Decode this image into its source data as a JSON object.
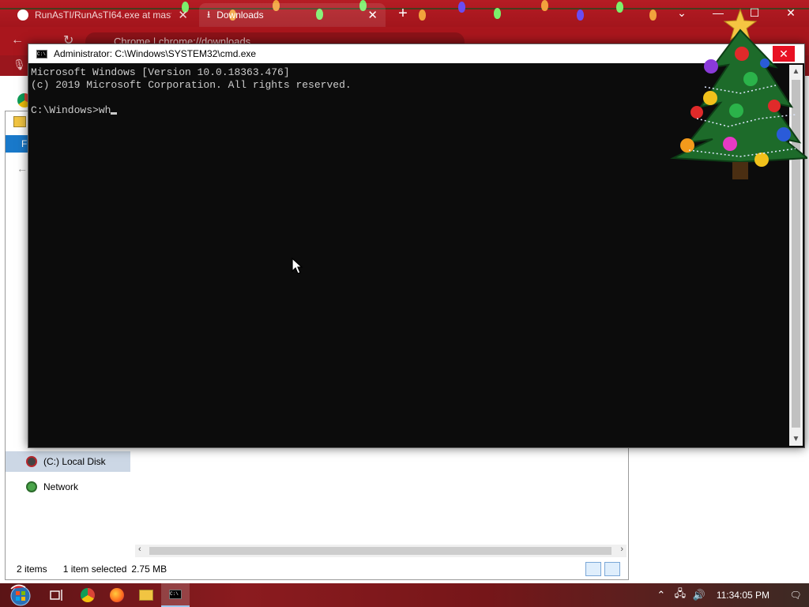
{
  "chrome": {
    "tabs": [
      {
        "label": "RunAsTI/RunAsTI64.exe at mast",
        "active": false
      },
      {
        "label": "Downloads",
        "active": true
      }
    ],
    "new_tab": "+",
    "address": "Chrome  |  chrome://downloads",
    "window_controls": {
      "minimize": "—",
      "maximize": "☐",
      "close": "✕"
    }
  },
  "explorer": {
    "ribbon_tab": "Fi",
    "nav": [
      {
        "label": "(C:) Local Disk",
        "icon": "drive-icon"
      },
      {
        "label": "Network",
        "icon": "network-icon"
      }
    ],
    "status": {
      "items": "2 items",
      "selected": "1 item selected",
      "size": "2.75 MB"
    }
  },
  "cmd": {
    "title": "Administrator: C:\\Windows\\SYSTEM32\\cmd.exe",
    "close": "✕",
    "lines": [
      "Microsoft Windows [Version 10.0.18363.476]",
      "(c) 2019 Microsoft Corporation. All rights reserved.",
      "",
      "C:\\Windows>wh"
    ],
    "colors": {
      "background": "#0c0c0c",
      "text": "#cccccc"
    }
  },
  "taskbar": {
    "buttons": [
      "start-button",
      "task-view-icon",
      "chrome-icon",
      "firefox-icon",
      "file-explorer-icon",
      "cmd-icon"
    ],
    "tray": {
      "chevron": "^",
      "clock": "11:34:05 PM"
    }
  }
}
